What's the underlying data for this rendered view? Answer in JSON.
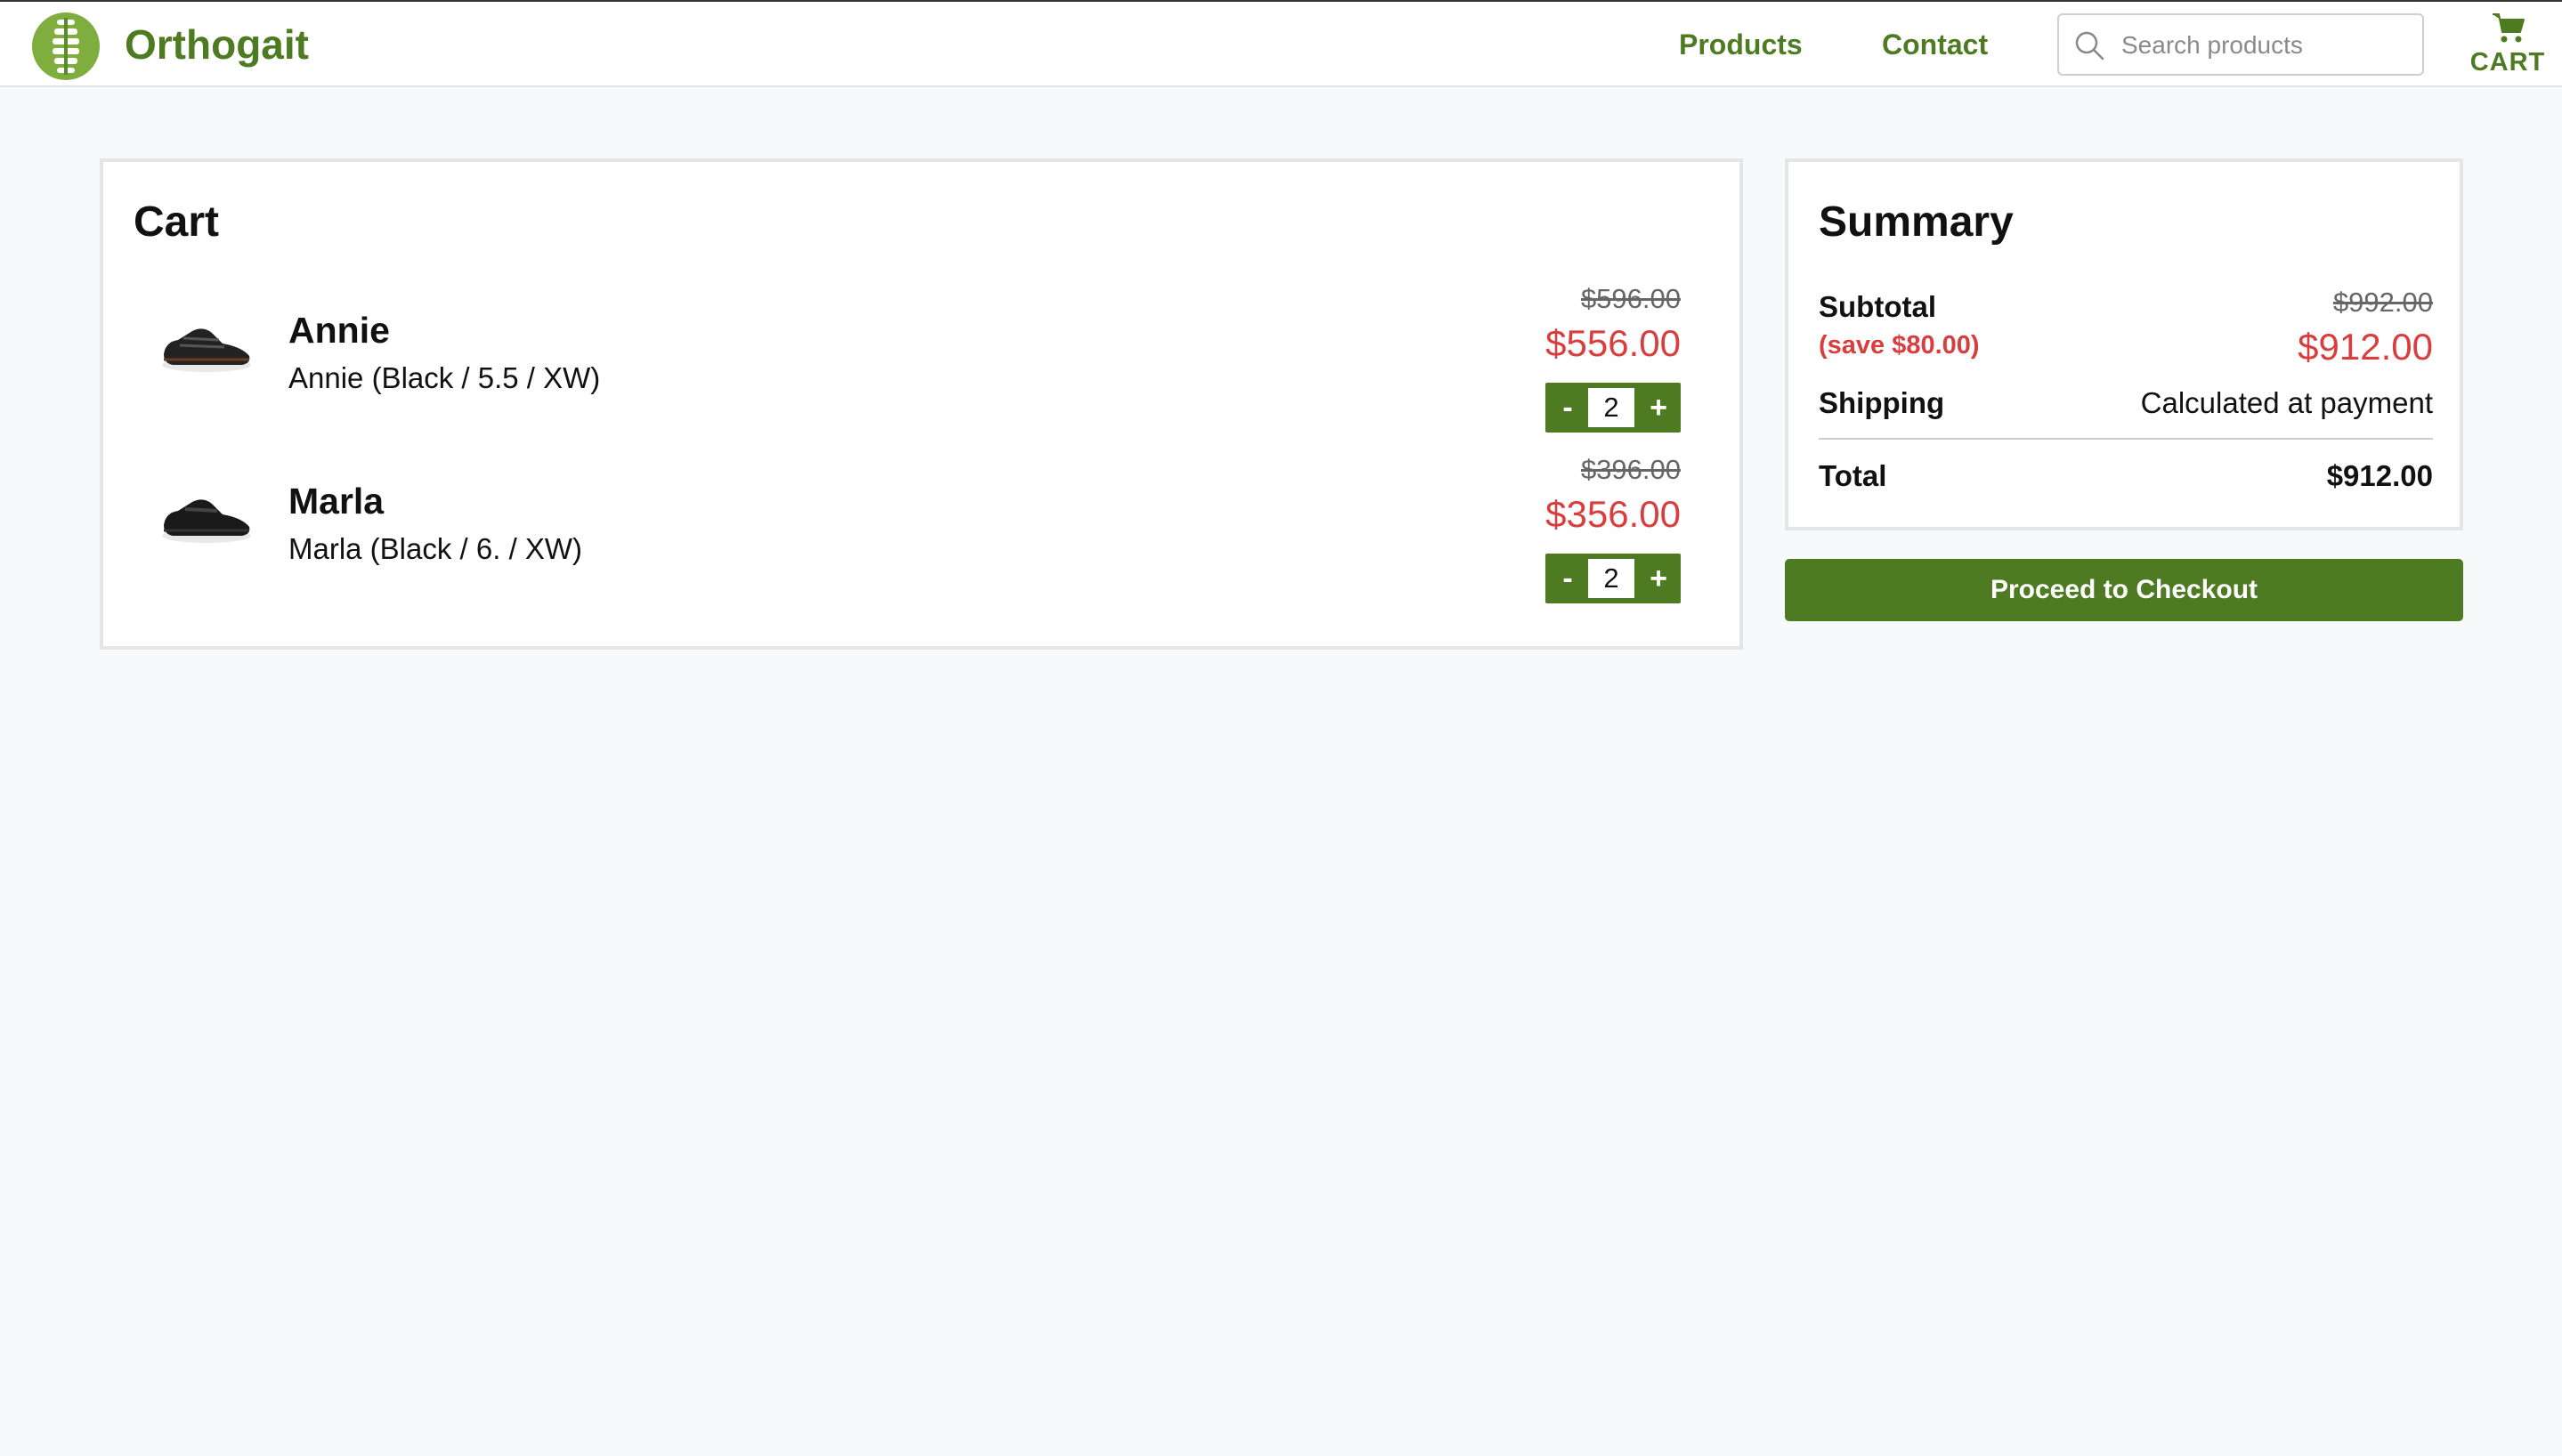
{
  "header": {
    "brand": "Orthogait",
    "nav": [
      "Products",
      "Contact"
    ],
    "search_placeholder": "Search products",
    "cart_label": "CART"
  },
  "cart": {
    "title": "Cart",
    "items": [
      {
        "name": "Annie",
        "variant": "Annie (Black / 5.5 / XW)",
        "original_price": "$596.00",
        "sale_price": "$556.00",
        "quantity": "2"
      },
      {
        "name": "Marla",
        "variant": "Marla (Black / 6. / XW)",
        "original_price": "$396.00",
        "sale_price": "$356.00",
        "quantity": "2"
      }
    ],
    "minus_label": "-",
    "plus_label": "+"
  },
  "summary": {
    "title": "Summary",
    "subtotal_label": "Subtotal",
    "save_note": "(save $80.00)",
    "subtotal_original": "$992.00",
    "subtotal_sale": "$912.00",
    "shipping_label": "Shipping",
    "shipping_value": "Calculated at payment",
    "total_label": "Total",
    "total_value": "$912.00"
  },
  "checkout_label": "Proceed to Checkout",
  "colors": {
    "brand_green": "#4e7a22",
    "sale_red": "#d93d3d",
    "background": "#f8f9fb"
  }
}
